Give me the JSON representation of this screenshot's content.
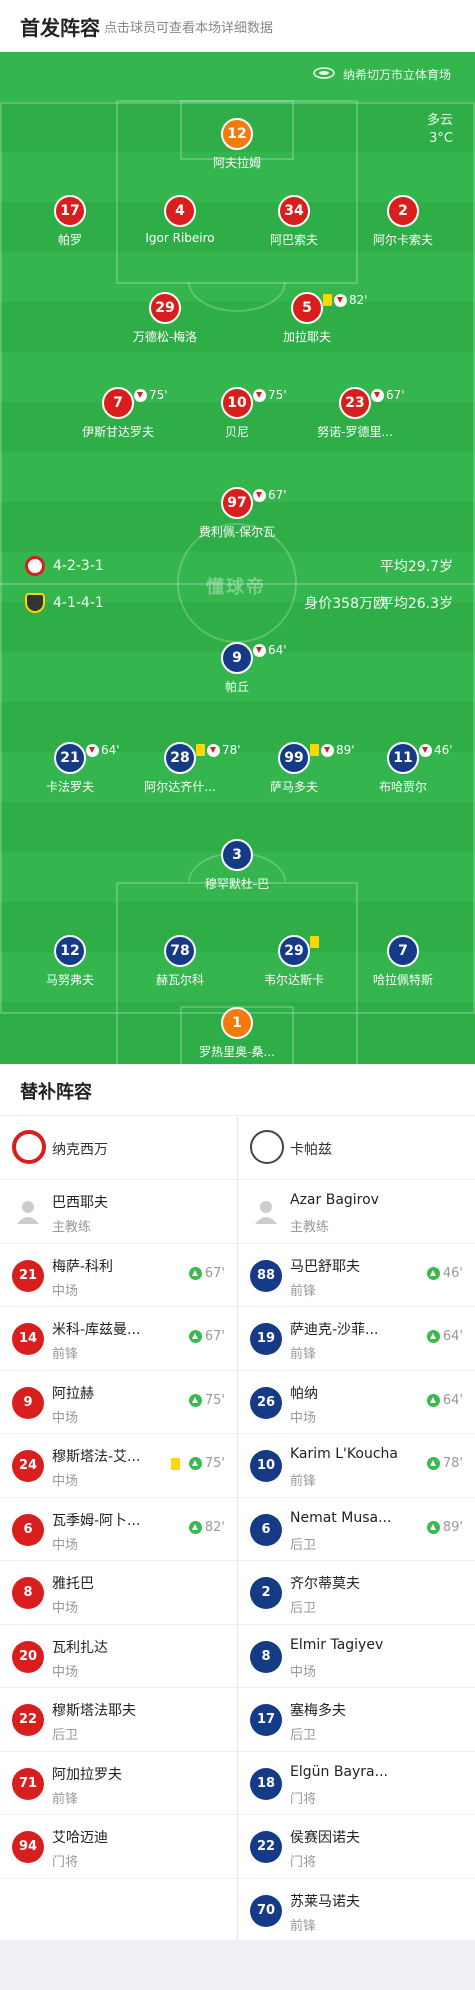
{
  "header": {
    "title": "首发阵容",
    "subtitle": "点击球员可查看本场详细数据"
  },
  "pitch": {
    "stadium": "纳希切万市立体育场",
    "weather": "多云",
    "temperature": "3°C",
    "watermark": "懂球帝",
    "home_formation": "4-2-3-1",
    "home_avg_age": "平均29.7岁",
    "away_formation": "4-1-4-1",
    "away_value": "身价358万欧",
    "away_avg_age": "平均26.3岁"
  },
  "colors": {
    "home": "#d91e1e",
    "away": "#153a86",
    "keeper": "#f47a0e",
    "pitch": "#2fae48"
  },
  "home_starters": [
    {
      "num": "12",
      "name": "阿夫拉姆",
      "color": "orange",
      "events": []
    },
    {
      "num": "17",
      "name": "帕罗",
      "color": "red",
      "events": []
    },
    {
      "num": "4",
      "name": "Igor Ribeiro",
      "color": "red",
      "events": []
    },
    {
      "num": "34",
      "name": "阿巴索夫",
      "color": "red",
      "events": []
    },
    {
      "num": "2",
      "name": "阿尔卡索夫",
      "color": "red",
      "events": []
    },
    {
      "num": "29",
      "name": "万德松-梅洛",
      "color": "red",
      "events": []
    },
    {
      "num": "5",
      "name": "加拉耶夫",
      "color": "red",
      "events": [
        "yellow",
        "sub"
      ],
      "minute": "82'"
    },
    {
      "num": "7",
      "name": "伊斯甘达罗夫",
      "color": "red",
      "events": [
        "sub"
      ],
      "minute": "75'"
    },
    {
      "num": "10",
      "name": "贝尼",
      "color": "red",
      "events": [
        "sub"
      ],
      "minute": "75'"
    },
    {
      "num": "23",
      "name": "努诺-罗德里...",
      "color": "red",
      "events": [
        "sub"
      ],
      "minute": "67'"
    },
    {
      "num": "97",
      "name": "费利佩-保尔瓦",
      "color": "red",
      "events": [
        "sub"
      ],
      "minute": "67'"
    }
  ],
  "away_starters": [
    {
      "num": "9",
      "name": "帕丘",
      "color": "blue",
      "events": [
        "sub"
      ],
      "minute": "64'"
    },
    {
      "num": "21",
      "name": "卡法罗夫",
      "color": "blue",
      "events": [
        "sub"
      ],
      "minute": "64'"
    },
    {
      "num": "28",
      "name": "阿尔达齐什...",
      "color": "blue",
      "events": [
        "yellow",
        "sub"
      ],
      "minute": "78'"
    },
    {
      "num": "99",
      "name": "萨马多夫",
      "color": "blue",
      "events": [
        "yellow",
        "sub"
      ],
      "minute": "89'"
    },
    {
      "num": "11",
      "name": "布哈贾尔",
      "color": "blue",
      "events": [
        "sub"
      ],
      "minute": "46'"
    },
    {
      "num": "3",
      "name": "穆罕默杜-巴",
      "color": "blue",
      "events": []
    },
    {
      "num": "12",
      "name": "马努弗夫",
      "color": "blue",
      "events": []
    },
    {
      "num": "78",
      "name": "赫瓦尔科",
      "color": "blue",
      "events": []
    },
    {
      "num": "29",
      "name": "韦尔达斯卡",
      "color": "blue",
      "events": [
        "yellow"
      ]
    },
    {
      "num": "7",
      "name": "哈拉佩特斯",
      "color": "blue",
      "events": []
    },
    {
      "num": "1",
      "name": "罗热里奥-桑...",
      "color": "orange",
      "events": []
    }
  ],
  "subs": {
    "title": "替补阵容",
    "home": {
      "team": "纳克西万",
      "coach": {
        "name": "巴西耶夫",
        "role": "主教练"
      },
      "players": [
        {
          "num": "21",
          "name": "梅萨-科利",
          "pos": "中场",
          "in": "67'",
          "yellow": false
        },
        {
          "num": "14",
          "name": "米科-库兹曼...",
          "pos": "前锋",
          "in": "67'",
          "yellow": false
        },
        {
          "num": "9",
          "name": "阿拉赫",
          "pos": "中场",
          "in": "75'",
          "yellow": false
        },
        {
          "num": "24",
          "name": "穆斯塔法-艾...",
          "pos": "中场",
          "in": "75'",
          "yellow": true
        },
        {
          "num": "6",
          "name": "瓦季姆-阿卜...",
          "pos": "中场",
          "in": "82'",
          "yellow": false
        },
        {
          "num": "8",
          "name": "雅托巴",
          "pos": "中场",
          "in": "",
          "yellow": false
        },
        {
          "num": "20",
          "name": "瓦利扎达",
          "pos": "中场",
          "in": "",
          "yellow": false
        },
        {
          "num": "22",
          "name": "穆斯塔法耶夫",
          "pos": "后卫",
          "in": "",
          "yellow": false
        },
        {
          "num": "71",
          "name": "阿加拉罗夫",
          "pos": "前锋",
          "in": "",
          "yellow": false
        },
        {
          "num": "94",
          "name": "艾哈迈迪",
          "pos": "门将",
          "in": "",
          "yellow": false
        }
      ]
    },
    "away": {
      "team": "卡帕兹",
      "coach": {
        "name": "Azar Bagirov",
        "role": "主教练"
      },
      "players": [
        {
          "num": "88",
          "name": "马巴舒耶夫",
          "pos": "前锋",
          "in": "46'",
          "yellow": false
        },
        {
          "num": "19",
          "name": "萨迪克-沙菲...",
          "pos": "前锋",
          "in": "64'",
          "yellow": false
        },
        {
          "num": "26",
          "name": "帕纳",
          "pos": "中场",
          "in": "64'",
          "yellow": false
        },
        {
          "num": "10",
          "name": "Karim L'Koucha",
          "pos": "前锋",
          "in": "78'",
          "yellow": false
        },
        {
          "num": "6",
          "name": "Nemat Musa...",
          "pos": "后卫",
          "in": "89'",
          "yellow": false
        },
        {
          "num": "2",
          "name": "齐尔蒂莫夫",
          "pos": "后卫",
          "in": "",
          "yellow": false
        },
        {
          "num": "8",
          "name": "Elmir Tagiyev",
          "pos": "中场",
          "in": "",
          "yellow": false
        },
        {
          "num": "17",
          "name": "塞梅多夫",
          "pos": "后卫",
          "in": "",
          "yellow": false
        },
        {
          "num": "18",
          "name": "Elgün Bayra...",
          "pos": "门将",
          "in": "",
          "yellow": false
        },
        {
          "num": "22",
          "name": "侯赛因诺夫",
          "pos": "门将",
          "in": "",
          "yellow": false
        },
        {
          "num": "70",
          "name": "苏莱马诺夫",
          "pos": "前锋",
          "in": "",
          "yellow": false
        }
      ]
    }
  }
}
